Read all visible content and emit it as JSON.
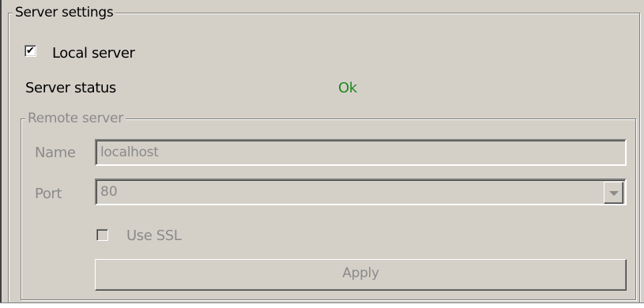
{
  "server_settings": {
    "group_title": "Server settings",
    "local_server": {
      "label": "Local server",
      "checked": true
    },
    "status": {
      "label": "Server status",
      "value": "Ok",
      "value_color": "#1e8a1e"
    },
    "remote_server": {
      "group_title": "Remote server",
      "name": {
        "label": "Name",
        "value": "localhost"
      },
      "port": {
        "label": "Port",
        "value": "80"
      },
      "use_ssl": {
        "label": "Use SSL",
        "checked": false
      },
      "apply_label": "Apply",
      "enabled": false
    }
  },
  "icons": {
    "checkmark": "✔",
    "dropdown": "chevron-down-icon"
  }
}
